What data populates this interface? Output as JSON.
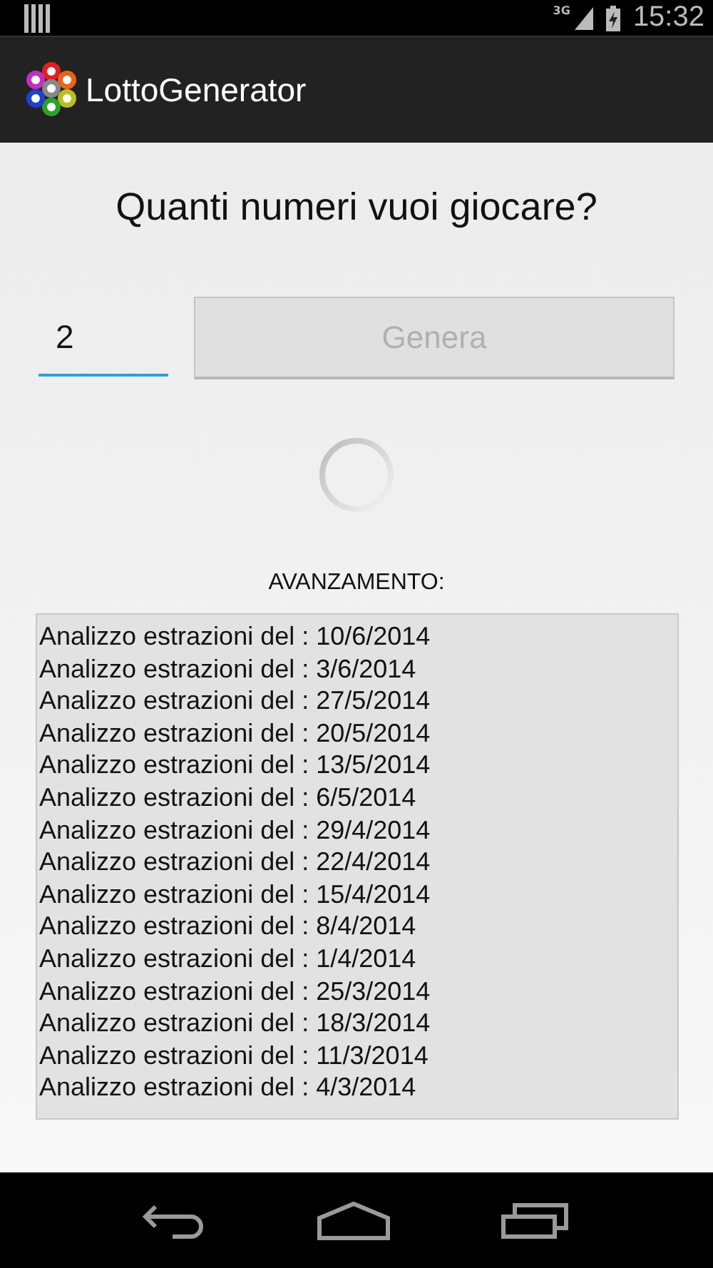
{
  "status_bar": {
    "network": "3G",
    "time": "15:32"
  },
  "action_bar": {
    "title": "LottoGenerator"
  },
  "prompt": "Quanti numeri vuoi giocare?",
  "count_field": {
    "value": "2"
  },
  "generate_button": {
    "label": "Genera",
    "disabled": true
  },
  "progress_label": "AVANZAMENTO:",
  "log_lines": [
    "Analizzo estrazioni del : 10/6/2014",
    "Analizzo estrazioni del : 3/6/2014",
    "Analizzo estrazioni del : 27/5/2014",
    "Analizzo estrazioni del : 20/5/2014",
    "Analizzo estrazioni del : 13/5/2014",
    "Analizzo estrazioni del : 6/5/2014",
    "Analizzo estrazioni del : 29/4/2014",
    "Analizzo estrazioni del : 22/4/2014",
    "Analizzo estrazioni del : 15/4/2014",
    "Analizzo estrazioni del : 8/4/2014",
    "Analizzo estrazioni del : 1/4/2014",
    "Analizzo estrazioni del : 25/3/2014",
    "Analizzo estrazioni del : 18/3/2014",
    "Analizzo estrazioni del : 11/3/2014",
    "Analizzo estrazioni del : 4/3/2014"
  ]
}
